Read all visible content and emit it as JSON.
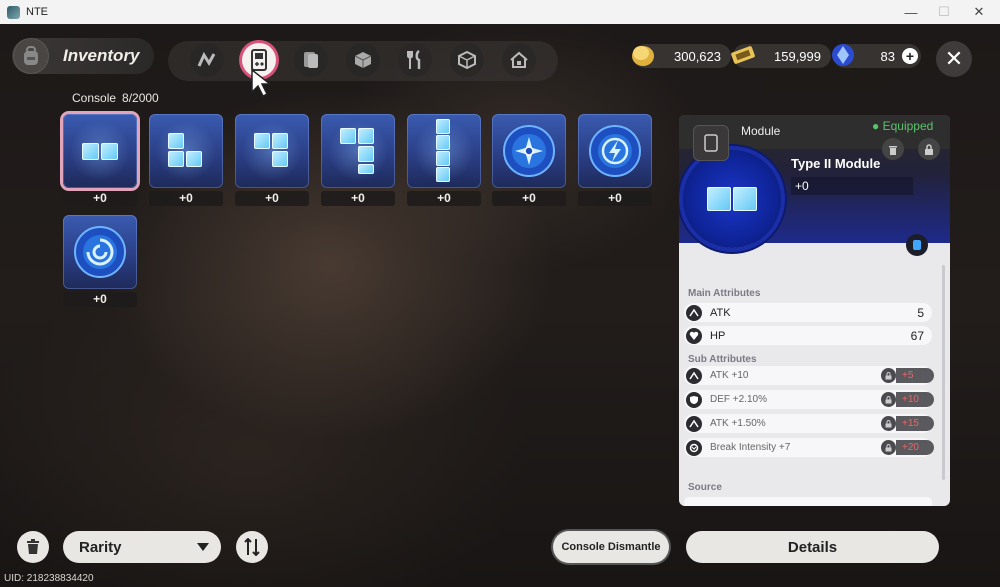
{
  "window": {
    "title": "NTE",
    "minimize": "—",
    "maximize": "☐",
    "close": "✕"
  },
  "header": {
    "title": "Inventory",
    "tabs": [
      "tab-nodes",
      "tab-console",
      "tab-cards",
      "tab-box",
      "tab-food",
      "tab-cube",
      "tab-home"
    ],
    "active_tab": 1,
    "currencies": [
      {
        "name": "gold-coin-icon",
        "value": "300,623"
      },
      {
        "name": "ticket-icon",
        "value": "159,999"
      },
      {
        "name": "crystal-icon",
        "value": "83"
      }
    ],
    "add_symbol": "+",
    "close_symbol": "✕"
  },
  "console": {
    "label": "Console",
    "count": "8/2000"
  },
  "items": [
    {
      "level": "+0",
      "shape": "double-block"
    },
    {
      "level": "+0",
      "shape": "l-block"
    },
    {
      "level": "+0",
      "shape": "j-block"
    },
    {
      "level": "+0",
      "shape": "s-block"
    },
    {
      "level": "+0",
      "shape": "i-block"
    },
    {
      "level": "+0",
      "shape": "compass-disc"
    },
    {
      "level": "+0",
      "shape": "bolt-disc"
    },
    {
      "level": "+0",
      "shape": "swirl-disc"
    }
  ],
  "panel": {
    "header_label": "Module",
    "equipped": "Equipped",
    "name": "Type II Module",
    "level": "+0",
    "main_title": "Main Attributes",
    "main": [
      {
        "name": "ATK",
        "value": "5",
        "icon": "atk-icon"
      },
      {
        "name": "HP",
        "value": "67",
        "icon": "hp-icon"
      }
    ],
    "sub_title": "Sub Attributes",
    "sub": [
      {
        "name": "ATK +10",
        "bonus": "+5",
        "icon": "atk-icon"
      },
      {
        "name": "DEF +2.10%",
        "bonus": "+10",
        "icon": "def-icon"
      },
      {
        "name": "ATK +1.50%",
        "bonus": "+15",
        "icon": "atk-icon"
      },
      {
        "name": "Break Intensity +7",
        "bonus": "+20",
        "icon": "break-icon"
      }
    ],
    "source_title": "Source"
  },
  "footer": {
    "rarity": "Rarity",
    "dismantle": "Console Dismantle",
    "details": "Details",
    "uid": "UID: 218238834420"
  },
  "colors": {
    "selection": "#d9527a",
    "equipped": "#5dc26c",
    "bonus": "#e26a6a",
    "item_blue": "#2b3f86"
  }
}
